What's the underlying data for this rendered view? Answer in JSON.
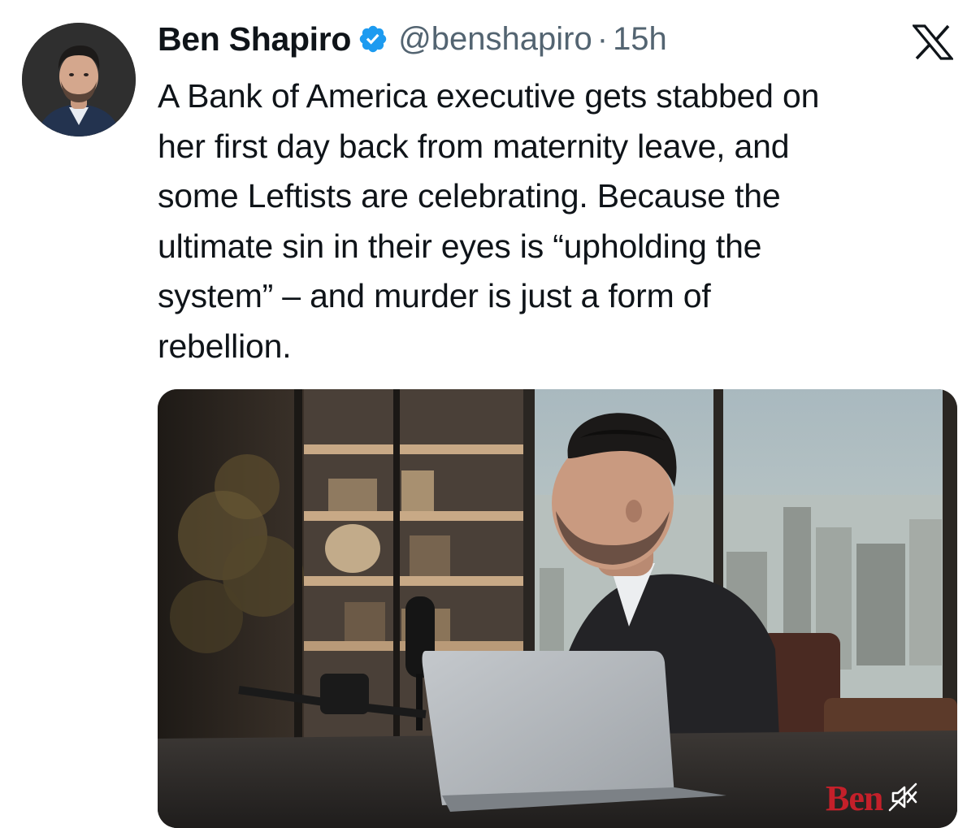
{
  "author": {
    "display_name": "Ben Shapiro",
    "verified_icon": "verified-badge-icon",
    "handle": "@benshapiro",
    "separator": "·",
    "time": "15h"
  },
  "platform_logo": "x-logo-icon",
  "tweet": {
    "lines": [
      "A Bank of America executive gets stabbed on",
      "her first day back from maternity leave, and",
      "some Leftists are celebrating. Because the",
      "ultimate sin in their eyes is “upholding the",
      "system” – and murder is just a form of",
      "rebellion."
    ]
  },
  "media": {
    "brand_mark": "Ben",
    "mute_icon": "speaker-muted-icon"
  },
  "colors": {
    "verified_blue": "#1d9bf0",
    "text_primary": "#0f1419",
    "text_secondary": "#536471",
    "brand_red": "#c4202a"
  }
}
